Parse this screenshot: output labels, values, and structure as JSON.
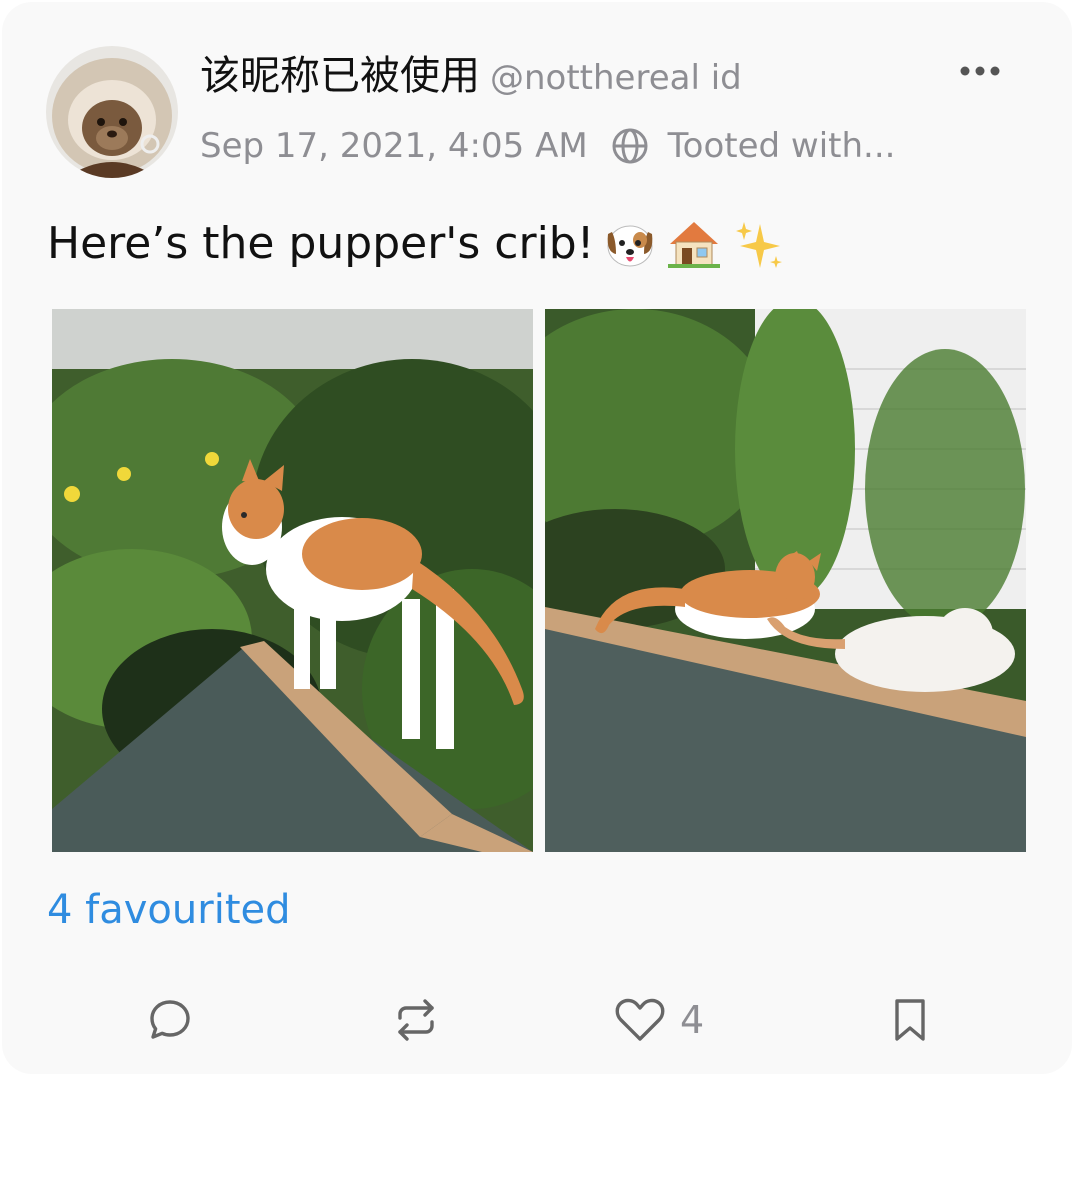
{
  "post": {
    "display_name": "该昵称已被使用",
    "handle": "@notthereal id",
    "timestamp": "Sep 17, 2021, 4:05 AM",
    "visibility_icon": "globe-icon",
    "client": "Tooted with...",
    "more_icon": "more-horizontal-icon",
    "text": "Here’s the pupper's crib!",
    "emojis": [
      "dog-face-emoji",
      "house-emoji",
      "sparkles-emoji"
    ],
    "favourited_label": "4 favourited"
  },
  "actions": {
    "reply_icon": "reply-icon",
    "boost_icon": "boost-icon",
    "favourite_icon": "heart-icon",
    "favourite_count": "4",
    "bookmark_icon": "bookmark-icon"
  },
  "colors": {
    "card_background": "#f9f9f9",
    "accent": "#2f8ce0",
    "secondary_text": "#8e8e93",
    "primary_text": "#111111"
  }
}
